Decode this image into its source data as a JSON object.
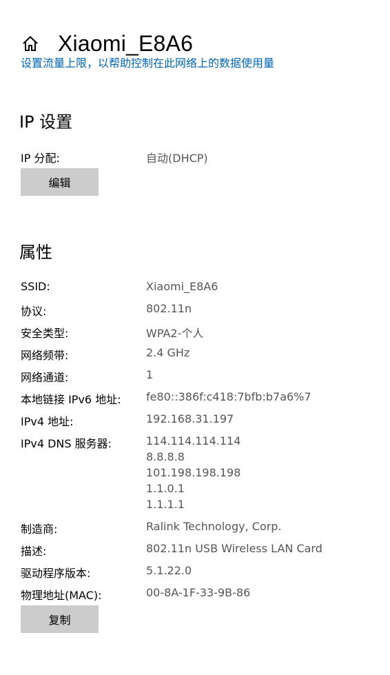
{
  "header": {
    "title": "Xiaomi_E8A6",
    "icon": "home-icon"
  },
  "data_limit_link": "设置流量上限，以帮助控制在此网络上的数据使用量",
  "ip_settings": {
    "heading": "IP 设置",
    "assignment_label": "IP 分配:",
    "assignment_value": "自动(DHCP)",
    "edit_button": "编辑"
  },
  "properties": {
    "heading": "属性",
    "ssid_label": "SSID:",
    "ssid_value": "Xiaomi_E8A6",
    "protocol_label": "协议:",
    "protocol_value": "802.11n",
    "security_label": "安全类型:",
    "security_value": "WPA2-个人",
    "band_label": "网络频带:",
    "band_value": "2.4 GHz",
    "channel_label": "网络通道:",
    "channel_value": "1",
    "ipv6_label": "本地链接 IPv6 地址:",
    "ipv6_value": "fe80::386f:c418:7bfb:b7a6%7",
    "ipv4_label": "IPv4 地址:",
    "ipv4_value": "192.168.31.197",
    "dns_label": "IPv4 DNS 服务器:",
    "dns_values": [
      "114.114.114.114",
      "8.8.8.8",
      "101.198.198.198",
      "1.1.0.1",
      "1.1.1.1"
    ],
    "manufacturer_label": "制造商:",
    "manufacturer_value": "Ralink Technology, Corp.",
    "description_label": "描述:",
    "description_value": "802.11n USB Wireless LAN Card",
    "driver_label": "驱动程序版本:",
    "driver_value": "5.1.22.0",
    "mac_label": "物理地址(MAC):",
    "mac_value": "00-8A-1F-33-9B-86",
    "copy_button": "复制"
  },
  "colors": {
    "link": "#0066b4",
    "button_bg": "#cccccc",
    "value_text": "#555555"
  }
}
